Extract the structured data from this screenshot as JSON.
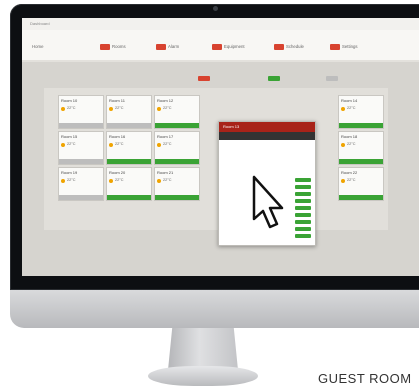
{
  "caption": "GUEST ROOM",
  "app": {
    "title": "Dashboard",
    "user": "",
    "help": "",
    "nav": [
      "Home",
      "Rooms",
      "Alarm",
      "Equipment",
      "Schedule",
      "Settings"
    ]
  },
  "legend": [
    {
      "label": "",
      "color": "#d8432f"
    },
    {
      "label": "",
      "color": "#3aa335"
    },
    {
      "label": "",
      "color": "#bdbdbd"
    }
  ],
  "rooms": [
    {
      "name": "Room 10",
      "temp": "22°C",
      "status": "grey"
    },
    {
      "name": "Room 11",
      "temp": "22°C",
      "status": "grey"
    },
    {
      "name": "Room 12",
      "temp": "22°C",
      "status": "green"
    },
    {
      "name": "Room 14",
      "temp": "22°C",
      "status": "green"
    },
    {
      "name": "Room 15",
      "temp": "22°C",
      "status": "grey"
    },
    {
      "name": "Room 16",
      "temp": "22°C",
      "status": "green"
    },
    {
      "name": "Room 17",
      "temp": "22°C",
      "status": "green"
    },
    {
      "name": "Room 18",
      "temp": "22°C",
      "status": "green"
    },
    {
      "name": "Room 19",
      "temp": "22°C",
      "status": "grey"
    },
    {
      "name": "Room 20",
      "temp": "22°C",
      "status": "green"
    },
    {
      "name": "Room 21",
      "temp": "22°C",
      "status": "green"
    },
    {
      "name": "Room 22",
      "temp": "22°C",
      "status": "green"
    }
  ],
  "popup": {
    "title": "Room 13",
    "subtitle": "",
    "rows": [
      "",
      "",
      "",
      "",
      "",
      "",
      "",
      "",
      "",
      "",
      "",
      "",
      ""
    ]
  },
  "colors": {
    "accent": "#d8432f",
    "ok": "#3aa335",
    "idle": "#bdbdbd"
  }
}
